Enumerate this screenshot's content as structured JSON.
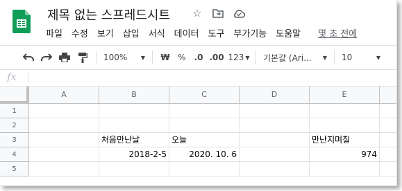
{
  "app": {
    "doc_title": "제목 없는 스프레드시트",
    "menu": [
      "파일",
      "수정",
      "보기",
      "삽입",
      "서식",
      "데이터",
      "도구",
      "부가기능",
      "도움말"
    ],
    "last_edit": "몇 초 전에"
  },
  "toolbar": {
    "undo_icon": "undo-icon",
    "redo_icon": "redo-icon",
    "print_icon": "print-icon",
    "paint_format_icon": "paint-format-icon",
    "zoom": "100%",
    "currency": "₩",
    "percent": "%",
    "decrease_decimal": ".0",
    "increase_decimal": ".00",
    "more_formats": "123",
    "font": "기본값 (Ari...",
    "font_size": "10"
  },
  "formula_bar": {
    "fx_label": "fx",
    "value": ""
  },
  "sheet": {
    "columns": [
      "A",
      "B",
      "C",
      "D",
      "E"
    ],
    "rows": [
      "1",
      "2",
      "3",
      "4",
      "5"
    ],
    "cells": {
      "B3": "처음만난날",
      "C3": "오늘",
      "E3": "만난지며칠",
      "B4": "2018-2-5",
      "C4": "2020. 10. 6",
      "E4": "974"
    }
  },
  "colors": {
    "sheets_green": "#0f9d58",
    "header_bg": "#f8f9fa",
    "grid_line": "#e2e2e2"
  }
}
